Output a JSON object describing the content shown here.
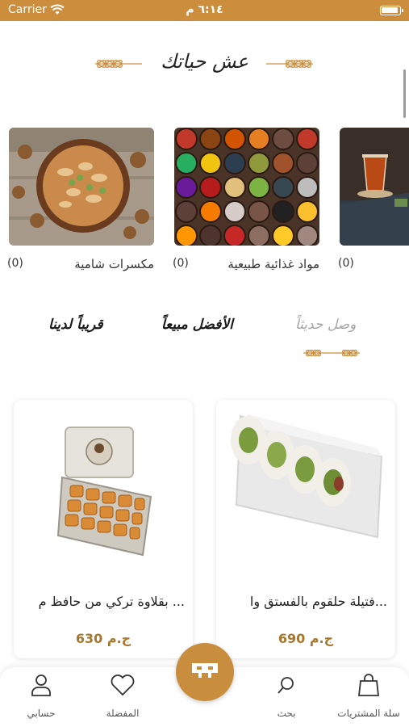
{
  "status_bar": {
    "carrier": "Carrier",
    "time": "٦:١٤ م"
  },
  "header": {
    "slogan": "عش حياتك"
  },
  "categories": [
    {
      "name": "مكسرات شامية",
      "count": "(0)",
      "image": "mixed-nuts"
    },
    {
      "name": "مواد غذائية طبيعية",
      "count": "(0)",
      "image": "spice-bowls"
    },
    {
      "name": "",
      "count": "(0)",
      "image": "turkish-tea"
    }
  ],
  "tabs": [
    {
      "label": "وصل حديثاً",
      "active": false
    },
    {
      "label": "الأفضل مبيعاً",
      "active": true
    },
    {
      "label": "قريباً لدينا",
      "active": true
    }
  ],
  "products": [
    {
      "name": "فتيلة حلقوم بالفستق وا...",
      "price": "690 ج.م",
      "image": "pistachio-turkish-delight"
    },
    {
      "name": "بقلاوة تركي من حافظ م ...",
      "price": "630 ج.م",
      "image": "baklava-tin"
    }
  ],
  "bottom_nav": {
    "cart": "سلة المشتريات",
    "search": "بحث",
    "favorites": "المفضلة",
    "account": "حسابي",
    "center_icon": "brand-logo-icon"
  },
  "colors": {
    "accent": "#cc8e3d",
    "price": "#a8772e"
  }
}
